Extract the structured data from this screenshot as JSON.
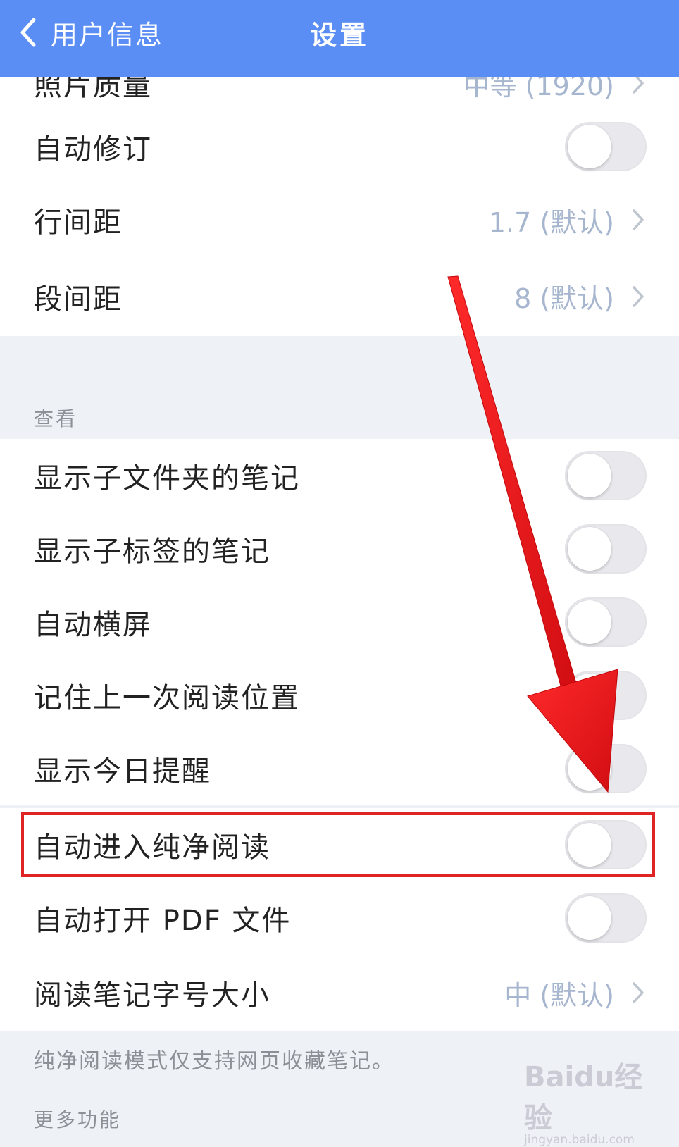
{
  "nav": {
    "back_label": "用户信息",
    "title": "设置"
  },
  "top_partial": {
    "label": "照片质量",
    "value": "中等 (1920)"
  },
  "rows_group1": [
    {
      "label": "自动修订",
      "type": "toggle",
      "on": false
    },
    {
      "label": "行间距",
      "type": "value",
      "value": "1.7 (默认)"
    },
    {
      "label": "段间距",
      "type": "value",
      "value": "8 (默认)"
    }
  ],
  "section_view": {
    "header": "查看"
  },
  "rows_group2": [
    {
      "label": "显示子文件夹的笔记",
      "type": "toggle",
      "on": false
    },
    {
      "label": "显示子标签的笔记",
      "type": "toggle",
      "on": false
    },
    {
      "label": "自动横屏",
      "type": "toggle",
      "on": false
    },
    {
      "label": "记住上一次阅读位置",
      "type": "toggle",
      "on": false
    },
    {
      "label": "显示今日提醒",
      "type": "toggle",
      "on": false
    },
    {
      "label": "自动进入纯净阅读",
      "type": "toggle",
      "on": false,
      "highlighted": true
    },
    {
      "label": "自动打开 PDF 文件",
      "type": "toggle",
      "on": false
    },
    {
      "label": "阅读笔记字号大小",
      "type": "value",
      "value": "中 (默认)"
    }
  ],
  "footnote": "纯净阅读模式仅支持网页收藏笔记。",
  "section_more": {
    "header": "更多功能"
  },
  "watermark": {
    "logo": "Baidu经验",
    "sub": "jingyan.baidu.com"
  },
  "colors": {
    "nav_bar": "#5b8ef5",
    "value_text": "#a7b6cf",
    "highlight": "#e02424",
    "arrow": "#e8141a"
  },
  "icons": {
    "back": "chevron-left-icon",
    "disclosure": "chevron-right-icon"
  }
}
